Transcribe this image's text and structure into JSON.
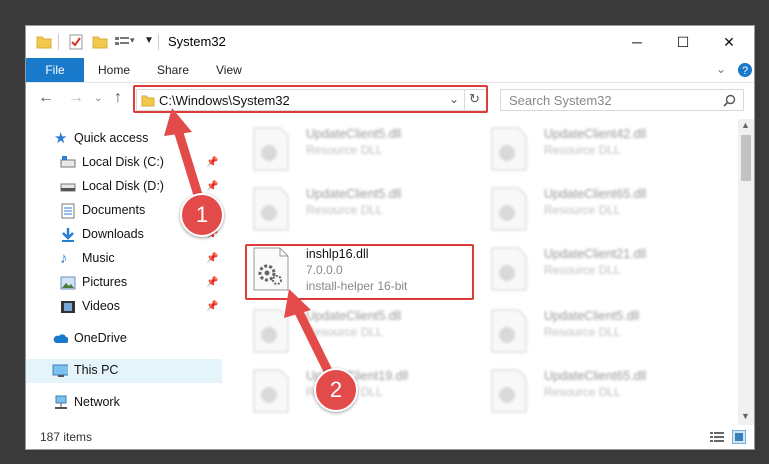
{
  "window": {
    "title": "System32",
    "minimize_glyph": "─",
    "maximize_glyph": "☐",
    "close_glyph": "✕"
  },
  "ribbon": {
    "tabs": [
      "File",
      "Home",
      "Share",
      "View"
    ]
  },
  "address": {
    "path": "C:\\Windows\\System32",
    "search_placeholder": "Search System32"
  },
  "sidebar": {
    "items": [
      {
        "label": "Quick access",
        "icon": "star-icon",
        "pinned": false
      },
      {
        "label": "Local Disk (C:)",
        "icon": "drive-icon",
        "pinned": true
      },
      {
        "label": "Local Disk (D:)",
        "icon": "drive-icon",
        "pinned": true
      },
      {
        "label": "Documents",
        "icon": "documents-icon",
        "pinned": true
      },
      {
        "label": "Downloads",
        "icon": "download-icon",
        "pinned": true
      },
      {
        "label": "Music",
        "icon": "music-icon",
        "pinned": true
      },
      {
        "label": "Pictures",
        "icon": "pictures-icon",
        "pinned": true
      },
      {
        "label": "Videos",
        "icon": "videos-icon",
        "pinned": true
      },
      {
        "label": "OneDrive",
        "icon": "cloud-icon",
        "pinned": false
      },
      {
        "label": "This PC",
        "icon": "computer-icon",
        "pinned": false
      },
      {
        "label": "Network",
        "icon": "network-icon",
        "pinned": false
      }
    ]
  },
  "files": [
    {
      "name": "UpdateClient5.dll",
      "desc": "Resource DLL"
    },
    {
      "name": "UpdateClient42.dll",
      "desc": "Resource DLL"
    },
    {
      "name": "UpdateClient5.dll",
      "desc": "Resource DLL"
    },
    {
      "name": "UpdateClient65.dll",
      "desc": "Resource DLL"
    },
    {
      "name": "inshlp16.dll",
      "version": "7.0.0.0",
      "desc": "install-helper 16-bit",
      "highlighted": true
    },
    {
      "name": "UpdateClient21.dll",
      "desc": "Resource DLL"
    },
    {
      "name": "UpdateClient5.dll",
      "desc": "Resource DLL"
    },
    {
      "name": "UpdateClient5.dll",
      "desc": "Resource DLL"
    },
    {
      "name": "UpdateClient19.dll",
      "desc": "Resource DLL"
    },
    {
      "name": "UpdateClient65.dll",
      "desc": "Resource DLL"
    }
  ],
  "status": {
    "item_count": "187 items"
  },
  "annotations": {
    "step1": "1",
    "step2": "2",
    "color": "#e03b3b"
  },
  "colors": {
    "accent": "#1979ca",
    "selected": "#e5f3fb"
  }
}
